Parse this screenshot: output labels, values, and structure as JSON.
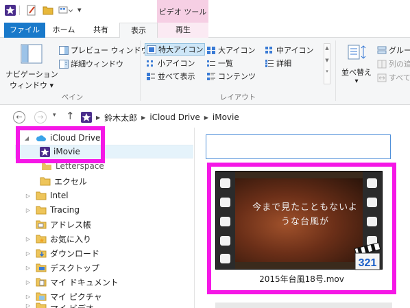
{
  "quick_access": {
    "dropdown_glyph": "▾"
  },
  "contextual_group": {
    "label": "ビデオ ツール"
  },
  "tabs": {
    "file": "ファイル",
    "home": "ホーム",
    "share": "共有",
    "view": "表示",
    "play": "再生"
  },
  "ribbon": {
    "navigation_pane": "ナビゲーション\nウィンドウ",
    "navigation_pane_line1": "ナビゲーション",
    "navigation_pane_line2": "ウィンドウ ▾",
    "preview_pane": "プレビュー ウィンドウ",
    "details_pane": "詳細ウィンドウ",
    "panes_group": "ペイン",
    "extra_large_icons": "特大アイコン",
    "large_icons": "大アイコン",
    "medium_icons": "中アイコン",
    "small_icons": "小アイコン",
    "list": "一覧",
    "details": "詳細",
    "tiles": "並べて表示",
    "content": "コンテンツ",
    "layout_group": "レイアウト",
    "sort_by_line1": "並べ替え",
    "sort_by_line2": "▾",
    "group_by": "グルー",
    "add_columns": "列の追",
    "size_all_columns": "すべて"
  },
  "address": {
    "crumbs": [
      "鈴木太郎",
      "iCloud Drive",
      "iMovie"
    ],
    "sep": "▶",
    "back": "←",
    "forward": "→",
    "recent": "▾",
    "up": "↑"
  },
  "tree": {
    "items": [
      {
        "label": "iCloud Drive",
        "expander": "◢"
      },
      {
        "label": "iMovie",
        "expander": ""
      },
      {
        "label": "Letterspace",
        "expander": ""
      },
      {
        "label": "エクセル",
        "expander": ""
      },
      {
        "label": "Intel",
        "expander": "▷"
      },
      {
        "label": "Tracing",
        "expander": "▷"
      },
      {
        "label": "アドレス帳",
        "expander": ""
      },
      {
        "label": "お気に入り",
        "expander": "▷"
      },
      {
        "label": "ダウンロード",
        "expander": "▷"
      },
      {
        "label": "デスクトップ",
        "expander": "▷"
      },
      {
        "label": "マイ ドキュメント",
        "expander": "▷"
      },
      {
        "label": "マイ ピクチャ",
        "expander": "▷"
      },
      {
        "label": "マイ ビデオ",
        "expander": "▷"
      }
    ]
  },
  "file": {
    "name": "2015年台風18号.mov",
    "subtitle_line1": "今まで見たこともないよ",
    "subtitle_line2": "うな台風が",
    "badge": "321"
  },
  "colors": {
    "highlight": "#f517e6",
    "file_tab": "#1979ca",
    "contextual": "#f6cfe4",
    "selection": "#e5f3fb"
  }
}
